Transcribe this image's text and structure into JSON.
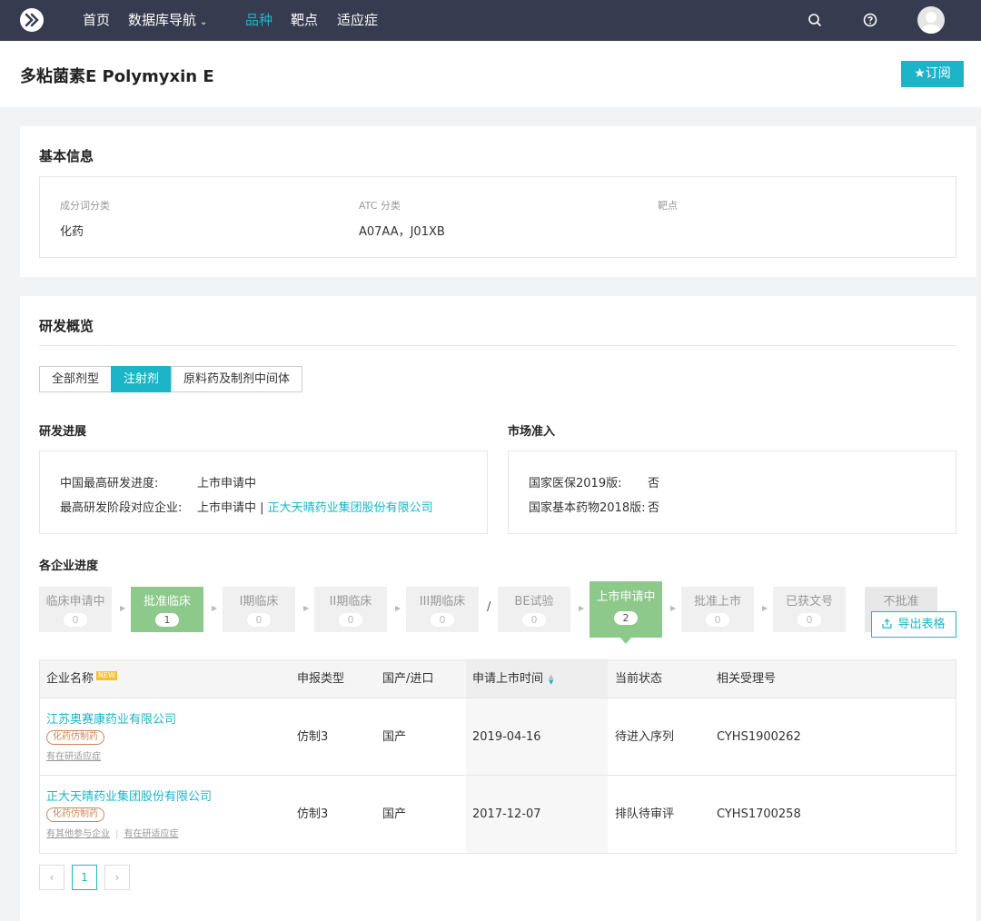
{
  "nav": {
    "items": [
      {
        "label": "首页"
      },
      {
        "label": "数据库导航"
      },
      {
        "label": "品种"
      },
      {
        "label": "靶点"
      },
      {
        "label": "适应症"
      }
    ],
    "accent": "#1cb5c7",
    "bg": "#373b4f"
  },
  "title": {
    "text": "多粘菌素E Polymyxin E",
    "subscribe": "★订阅"
  },
  "basic": {
    "title": "基本信息",
    "cols": [
      {
        "label": "成分词分类",
        "value": "化药"
      },
      {
        "label": "ATC 分类",
        "value": "A07AA，J01XB"
      },
      {
        "label": "靶点",
        "value": ""
      }
    ]
  },
  "dev": {
    "title": "研发概览",
    "tabs": [
      {
        "label": "全部剂型"
      },
      {
        "label": "注射剂"
      },
      {
        "label": "原料药及制剂中间体"
      }
    ],
    "progress": {
      "title": "研发进展",
      "rows": [
        {
          "label": "中国最高研发进度:",
          "value": "上市申请中",
          "link": ""
        },
        {
          "label": "最高研发阶段对应企业:",
          "value": "上市申请中 | ",
          "link": "正大天晴药业集团股份有限公司"
        }
      ]
    },
    "market": {
      "title": "市场准入",
      "rows": [
        {
          "label": "国家医保2019版:",
          "value": "否"
        },
        {
          "label": "国家基本药物2018版:",
          "value": "否"
        }
      ]
    },
    "stages_title": "各企业进度",
    "stages": [
      {
        "name": "临床申请中",
        "count": "0"
      },
      {
        "name": "批准临床",
        "count": "1"
      },
      {
        "name": "I期临床",
        "count": "0"
      },
      {
        "name": "II期临床",
        "count": "0"
      },
      {
        "name": "III期临床",
        "count": "0"
      },
      {
        "name": "BE试验",
        "count": "0"
      },
      {
        "name": "上市申请中",
        "count": "2"
      },
      {
        "name": "批准上市",
        "count": "0"
      },
      {
        "name": "已获文号",
        "count": "0"
      },
      {
        "name": "不批准",
        "count": ""
      }
    ],
    "slash": "/",
    "export": "导出表格"
  },
  "table": {
    "headers": {
      "company": "企业名称",
      "new": "NEW",
      "type": "申报类型",
      "origin": "国产/进口",
      "date": "申请上市时间",
      "status": "当前状态",
      "acc": "相关受理号"
    },
    "rows": [
      {
        "company": "江苏奥赛康药业有限公司",
        "tag": "化药仿制药",
        "link1": "有在研适应症",
        "link2": "",
        "type": "仿制3",
        "origin": "国产",
        "date": "2019-04-16",
        "status": "待进入序列",
        "acc": "CYHS1900262"
      },
      {
        "company": "正大天晴药业集团股份有限公司",
        "tag": "化药仿制药",
        "link1": "有其他参与企业",
        "link2": "有在研适应症",
        "type": "仿制3",
        "origin": "国产",
        "date": "2017-12-07",
        "status": "排队待审评",
        "acc": "CYHS1700258"
      }
    ]
  },
  "pager": {
    "prev": "‹",
    "current": "1",
    "next": "›"
  }
}
